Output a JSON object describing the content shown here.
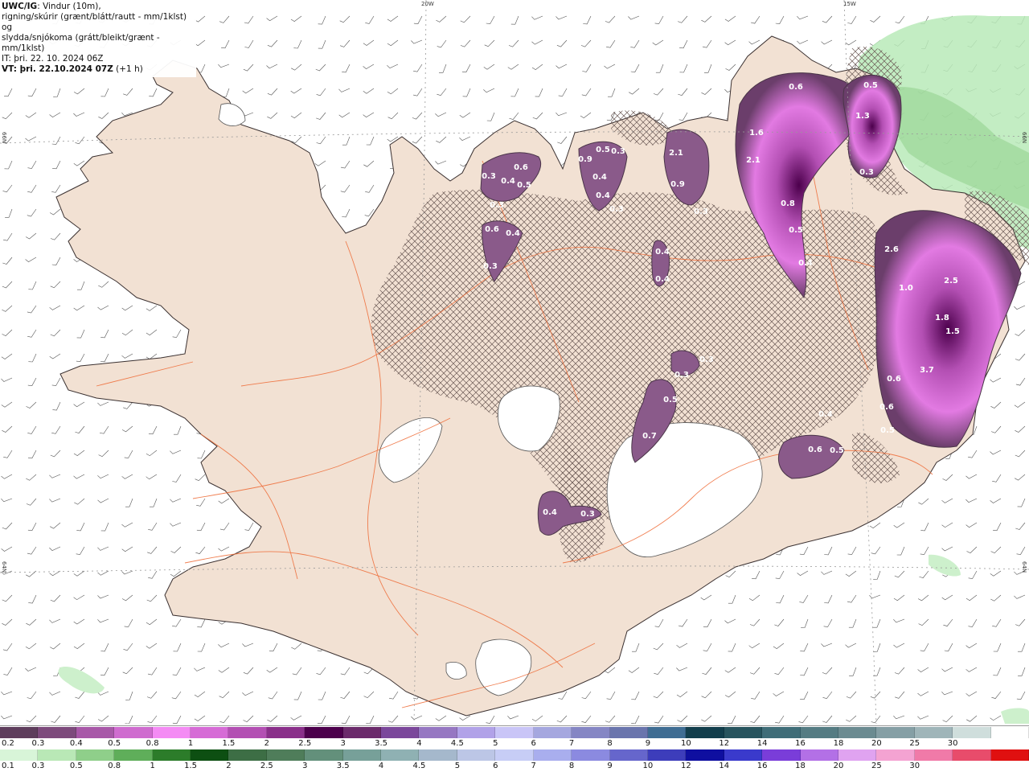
{
  "header": {
    "product": "UWC/IG",
    "line1": ": Vindur (10m),",
    "line2": "rigning/skúrir (grænt/blátt/rautt - mm/1klst) og",
    "line3": "slydda/snjókoma (grátt/bleikt/grænt - mm/1klst)",
    "it_label": "IT:",
    "it_value": " þri. 22. 10. 2024 06Z",
    "vt_label": "VT: þri. 22.10.2024 07Z",
    "vt_suffix": " (+1 h)"
  },
  "coords": {
    "lon_20w": "20W",
    "lon_15w": "15W",
    "lat_66n_left": "66N",
    "lat_66n_right": "66N",
    "lat_64n_left": "64N",
    "lat_64n_right": "64N"
  },
  "map_labels": [
    {
      "text": "0.3"
    },
    {
      "text": "0.4"
    },
    {
      "text": "0.6"
    },
    {
      "text": "0.5"
    },
    {
      "text": "0.3"
    },
    {
      "text": "0.6"
    },
    {
      "text": "0.4"
    },
    {
      "text": "0.3"
    },
    {
      "text": "0.9"
    },
    {
      "text": "0.5"
    },
    {
      "text": "0.3"
    },
    {
      "text": "0.4"
    },
    {
      "text": "0.4"
    },
    {
      "text": "0.3"
    },
    {
      "text": "2.1"
    },
    {
      "text": "0.9"
    },
    {
      "text": "0.3"
    },
    {
      "text": "1.6"
    },
    {
      "text": "2.1"
    },
    {
      "text": "0.6"
    },
    {
      "text": "0.8"
    },
    {
      "text": "0.5"
    },
    {
      "text": "0.4"
    },
    {
      "text": "0.5"
    },
    {
      "text": "1.3"
    },
    {
      "text": "0.3"
    },
    {
      "text": "0.4"
    },
    {
      "text": "0.4"
    },
    {
      "text": "2.6"
    },
    {
      "text": "1.0"
    },
    {
      "text": "2.5"
    },
    {
      "text": "1.8"
    },
    {
      "text": "1.5"
    },
    {
      "text": "3.7"
    },
    {
      "text": "0.6"
    },
    {
      "text": "0.6"
    },
    {
      "text": "0.5"
    },
    {
      "text": "0.3"
    },
    {
      "text": "0.3"
    },
    {
      "text": "0.5"
    },
    {
      "text": "0.7"
    },
    {
      "text": "0.4"
    },
    {
      "text": "0.6"
    },
    {
      "text": "0.5"
    },
    {
      "text": "0.4"
    },
    {
      "text": "0.3"
    }
  ],
  "legend": {
    "snow": {
      "colors": [
        "#5e3d5c",
        "#7d4a7c",
        "#a858a8",
        "#cf6ccf",
        "#f48bf4",
        "#d66bd6",
        "#b34fb3",
        "#8a2f8a",
        "#4c004c",
        "#6b2a6b",
        "#7b479b",
        "#9677c2",
        "#b1a2e8",
        "#c9c5f7",
        "#a5a7df",
        "#8586c4",
        "#6a75ad",
        "#3f6d93",
        "#123e4c",
        "#27545e",
        "#3f6d78",
        "#557c83",
        "#6b8b91",
        "#859fa5",
        "#9fb5b9",
        "#cfdedc",
        "#ffffff"
      ],
      "ticks": [
        "0.2",
        "0.3",
        "0.4",
        "0.5",
        "0.8",
        "1",
        "1.5",
        "2",
        "2.5",
        "3",
        "3.5",
        "4",
        "4.5",
        "5",
        "6",
        "7",
        "8",
        "9",
        "10",
        "12",
        "14",
        "16",
        "18",
        "20",
        "25",
        "30"
      ]
    },
    "rain": {
      "colors": [
        "#d8f5d8",
        "#b9e8b6",
        "#8fcf8a",
        "#5fae5a",
        "#2c7c2a",
        "#0d4f12",
        "#3d6e45",
        "#4f7d5a",
        "#63907b",
        "#77a099",
        "#8fb1b3",
        "#a5b8cc",
        "#bcc6e6",
        "#c7cdf6",
        "#a9aeee",
        "#8b8ae0",
        "#6666cc",
        "#3d3dbb",
        "#0f0fa0",
        "#3a3acc",
        "#7a3dd9",
        "#b370e6",
        "#e0a3f0",
        "#f4a3d2",
        "#f07aa8",
        "#e84c6b",
        "#e01010"
      ],
      "ticks": [
        "0.1",
        "0.3",
        "0.5",
        "0.8",
        "1",
        "1.5",
        "2",
        "2.5",
        "3",
        "3.5",
        "4",
        "4.5",
        "5",
        "6",
        "7",
        "8",
        "9",
        "10",
        "12",
        "14",
        "16",
        "18",
        "20",
        "25",
        "30"
      ]
    }
  }
}
